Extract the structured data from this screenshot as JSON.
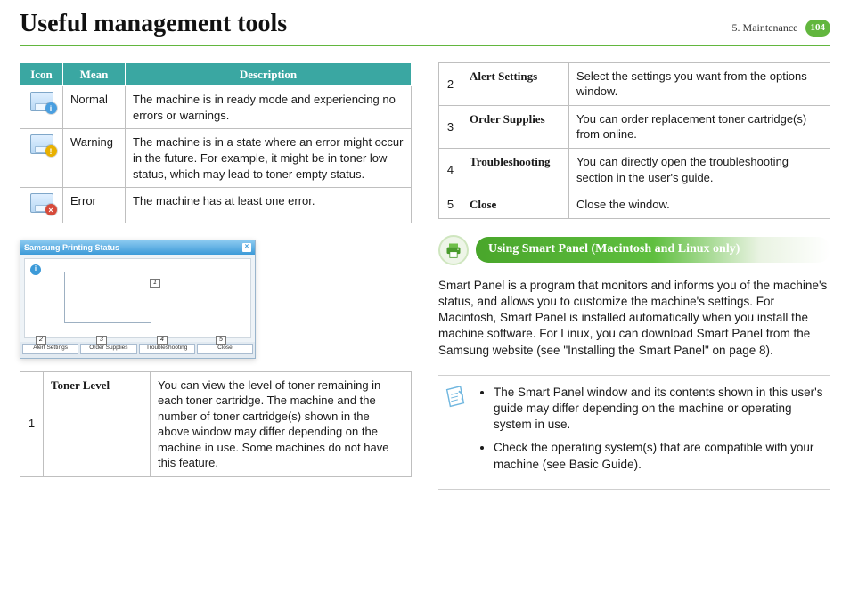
{
  "header": {
    "title": "Useful management tools",
    "chapter": "5.  Maintenance",
    "page": "104"
  },
  "icon_table": {
    "headers": {
      "icon": "Icon",
      "mean": "Mean",
      "desc": "Description"
    },
    "rows": [
      {
        "icon": "printer-normal-icon",
        "badge": "i",
        "mean": "Normal",
        "desc": "The machine is in ready mode and experiencing no errors or warnings."
      },
      {
        "icon": "printer-warning-icon",
        "badge": "!",
        "mean": "Warning",
        "desc": "The machine is in a state where an error might occur in the future. For example, it might be in toner low status, which may lead to toner empty status."
      },
      {
        "icon": "printer-error-icon",
        "badge": "×",
        "mean": "Error",
        "desc": "The machine has at least one error."
      }
    ]
  },
  "shot": {
    "title": "Samsung Printing Status",
    "callouts": [
      "1",
      "2",
      "3",
      "4",
      "5"
    ],
    "buttons": [
      "Alert Settings",
      "Order Supplies",
      "Troubleshooting",
      "Close"
    ]
  },
  "left_feature": {
    "num": "1",
    "name": "Toner Level",
    "desc": "You can view the level of toner remaining in each toner cartridge. The machine and the number of toner cartridge(s) shown in the above window may differ depending on the machine in use. Some machines do not have this feature."
  },
  "right_features": [
    {
      "num": "2",
      "name": "Alert Settings",
      "desc": "Select the settings you want from the options window."
    },
    {
      "num": "3",
      "name": "Order Supplies",
      "desc": "You can order replacement toner cartridge(s) from online."
    },
    {
      "num": "4",
      "name": "Troubleshooting",
      "desc": "You can directly open the troubleshooting section in the user's guide."
    },
    {
      "num": "5",
      "name": "Close",
      "desc": "Close the window."
    }
  ],
  "section_title": "Using Smart Panel (Macintosh and Linux only)",
  "paragraph": "Smart Panel is a program that monitors and informs you of the machine's status, and allows you to customize the machine's settings. For Macintosh, Smart Panel is installed automatically when you install the machine software. For Linux, you can download Smart Panel from the Samsung website (see \"Installing the Smart Panel\" on page 8).",
  "note": {
    "items": [
      "The Smart Panel window and its contents shown in this user's guide may differ depending on the machine or operating system in use.",
      "Check the operating system(s) that are compatible with your machine (see Basic Guide)."
    ]
  }
}
